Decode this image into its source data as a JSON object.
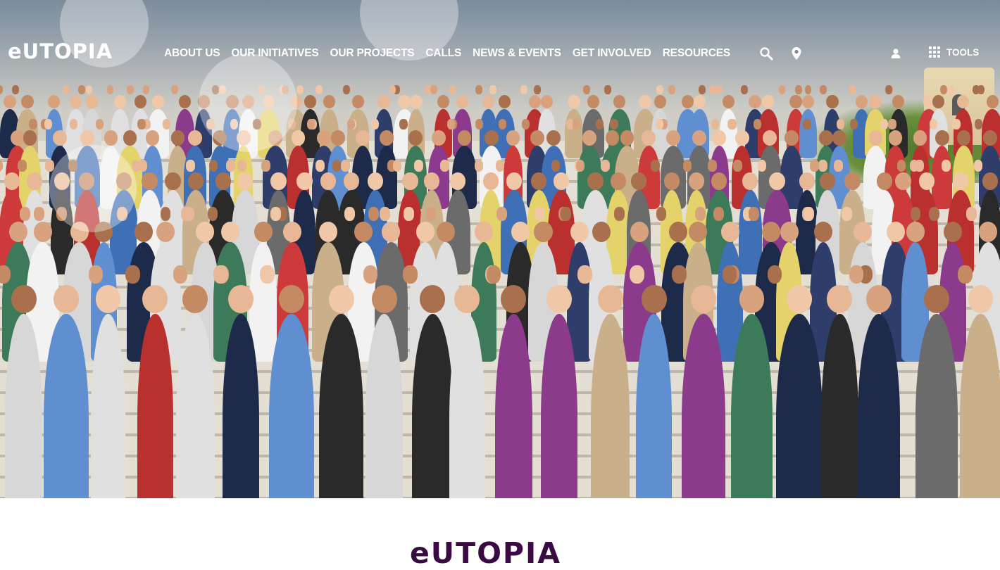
{
  "brand": {
    "logo_text": "eUTOPIA",
    "primary_color": "#3a0a43",
    "nav_text_color": "#ffffff"
  },
  "nav": {
    "items": [
      {
        "label": "ABOUT US"
      },
      {
        "label": "OUR INITIATIVES"
      },
      {
        "label": "OUR PROJECTS"
      },
      {
        "label": "CALLS"
      },
      {
        "label": "NEWS & EVENTS"
      },
      {
        "label": "GET INVOLVED"
      },
      {
        "label": "RESOURCES"
      }
    ],
    "icons": [
      "search-icon",
      "map-pin-icon",
      "user-icon",
      "grid-icon"
    ],
    "tools_label": "TOOLS"
  },
  "hero": {
    "image": "group-photo-waving-on-stairs"
  },
  "section": {
    "logo_text": "eUTOPIA"
  }
}
